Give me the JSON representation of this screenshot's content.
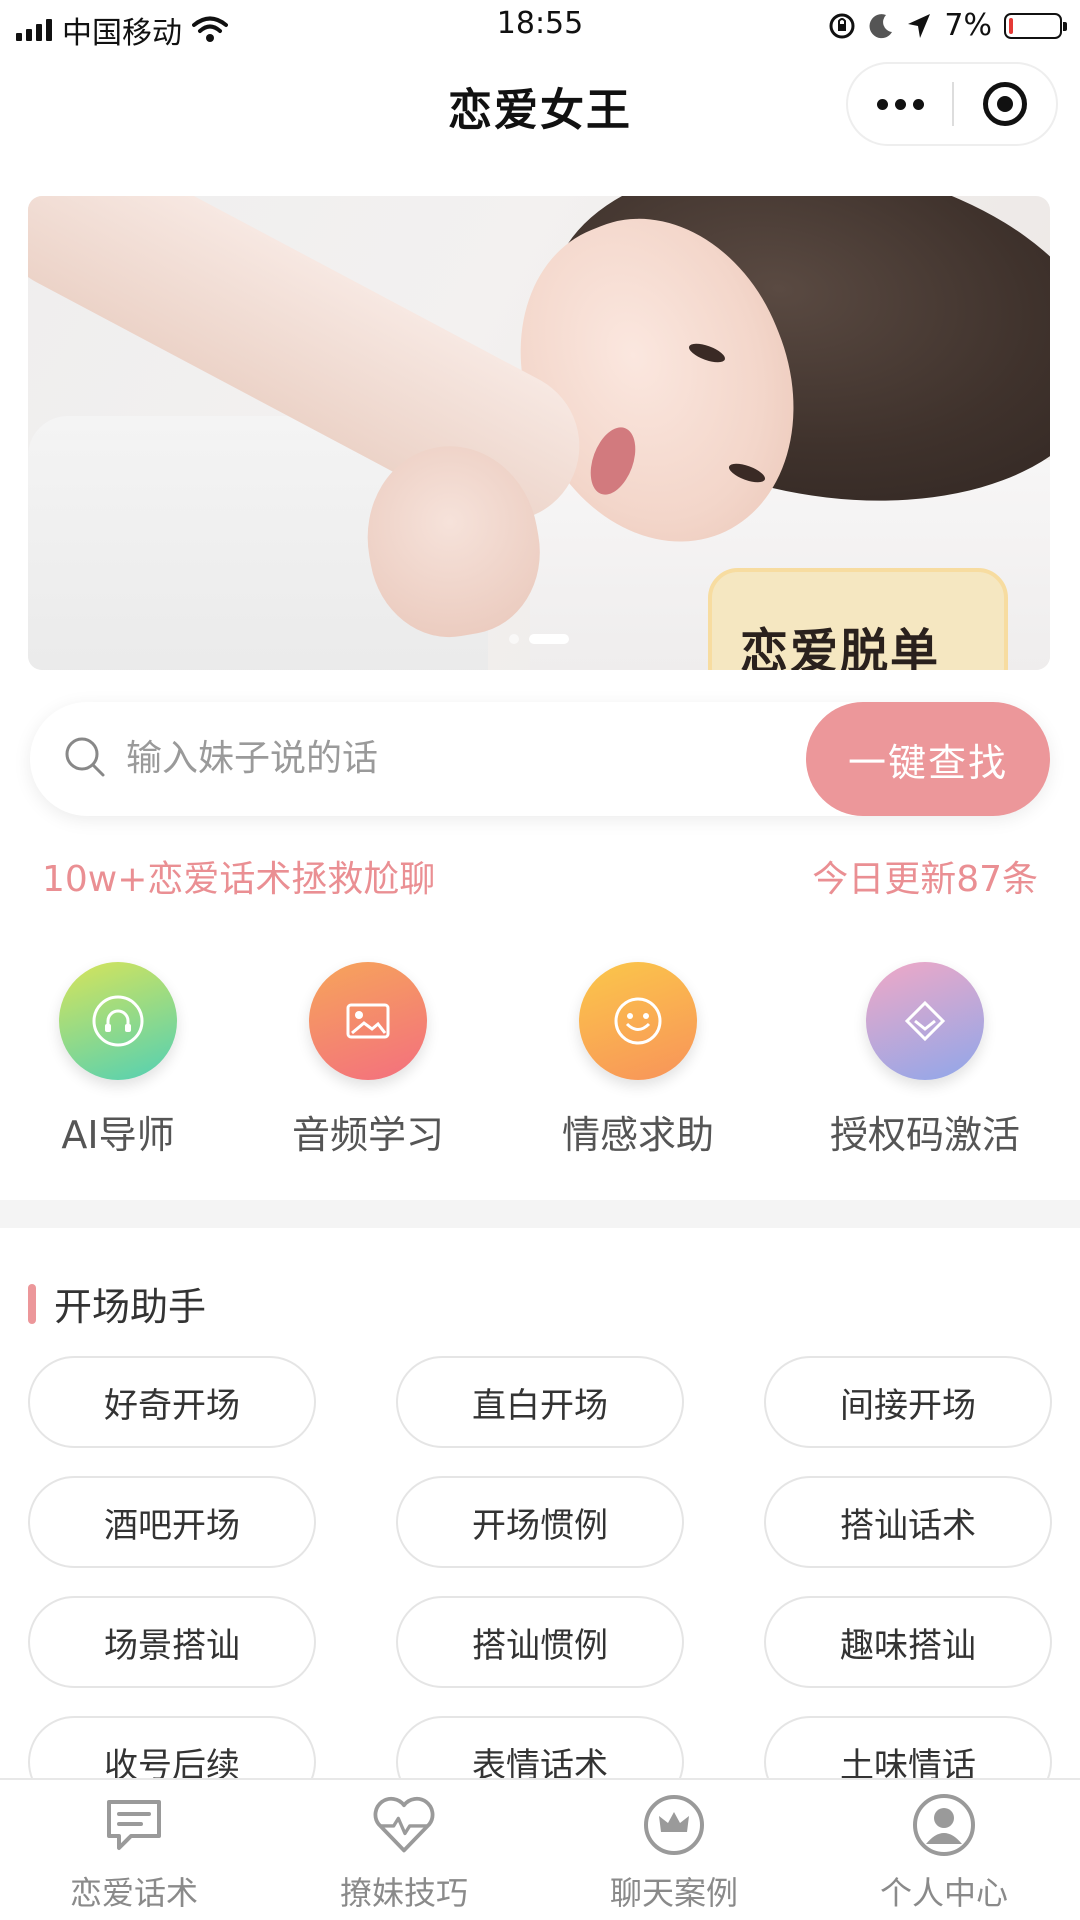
{
  "status_bar": {
    "carrier": "中国移动",
    "time": "18:55",
    "battery": "7%"
  },
  "nav": {
    "title": "恋爱女王"
  },
  "banner": {
    "sticker_text": "恋爱脱单",
    "slide_count": 2,
    "active_slide": 2
  },
  "search": {
    "placeholder": "输入妹子说的话",
    "button_label": "一键查找"
  },
  "promo": {
    "left_text": "10w+恋爱话术拯救尬聊",
    "right_text": "今日更新87条"
  },
  "quick_tiles": [
    {
      "label": "AI导师",
      "icon": "headphones-icon",
      "gradient": [
        "#d7e45a",
        "#52d0b4"
      ]
    },
    {
      "label": "音频学习",
      "icon": "image-icon",
      "gradient": [
        "#f6a55a",
        "#f36f7f"
      ]
    },
    {
      "label": "情感求助",
      "icon": "smiley-icon",
      "gradient": [
        "#fbc74a",
        "#f8935a"
      ]
    },
    {
      "label": "授权码激活",
      "icon": "diamond-icon",
      "gradient": [
        "#f0a8c6",
        "#8fa7ea"
      ]
    }
  ],
  "section": {
    "title": "开场助手"
  },
  "chips": [
    "好奇开场",
    "直白开场",
    "间接开场",
    "酒吧开场",
    "开场惯例",
    "搭讪话术",
    "场景搭讪",
    "搭讪惯例",
    "趣味搭讪",
    "收号后续",
    "表情话术",
    "土味情话"
  ],
  "tabbar": [
    {
      "label": "恋爱话术",
      "icon": "chat-bubble-icon"
    },
    {
      "label": "撩妹技巧",
      "icon": "heart-pulse-icon"
    },
    {
      "label": "聊天案例",
      "icon": "crown-icon"
    },
    {
      "label": "个人中心",
      "icon": "user-avatar-icon"
    }
  ],
  "colors": {
    "accent": "#ec979a",
    "promo_text": "#ea8f93"
  }
}
